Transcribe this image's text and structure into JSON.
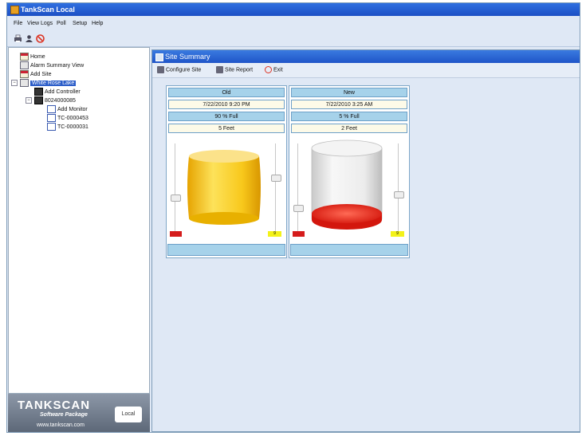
{
  "window": {
    "title": "TankScan Local"
  },
  "menu": [
    "File",
    "View Logs",
    "Poll",
    "Setup",
    "Help"
  ],
  "toolbar_icons": [
    "print-icon",
    "user-icon",
    "stop-icon"
  ],
  "tree": {
    "home": "Home",
    "alarm_summary": "Alarm Summary View",
    "add_site": "Add Site",
    "selected_site": "White Rose Lake",
    "add_controller": "Add Controller",
    "controller_id": "8024000085",
    "add_monitor": "Add Monitor",
    "monitor_1": "TC-0000453",
    "monitor_2": "TC-0000031"
  },
  "brand": {
    "name": "TANKSCAN",
    "tagline": "Software Package",
    "url": "www.tankscan.com",
    "edition": "Local"
  },
  "panel": {
    "title": "Site Summary",
    "configure_site": "Configure Site",
    "site_report": "Site Report",
    "exit": "Exit"
  },
  "tanks": [
    {
      "name": "Old",
      "timestamp": "7/22/2010 9:20 PM",
      "percent_full_text": "90 % Full",
      "level_text": "5 Feet",
      "fill_fraction": 0.9,
      "fill_color": "#f2c618",
      "high_alarm": "9"
    },
    {
      "name": "New",
      "timestamp": "7/22/2010 3:25 AM",
      "percent_full_text": "5 % Full",
      "level_text": "2 Feet",
      "fill_fraction": 0.05,
      "fill_color": "#e62a1a",
      "high_alarm": "9"
    }
  ],
  "colors": {
    "title_blue": "#2f6fe0",
    "panel_bg": "#dfe8f5",
    "header_cell": "#a6d2ea",
    "alarm_red": "#d51c1c",
    "alarm_yellow": "#f3f21a"
  }
}
